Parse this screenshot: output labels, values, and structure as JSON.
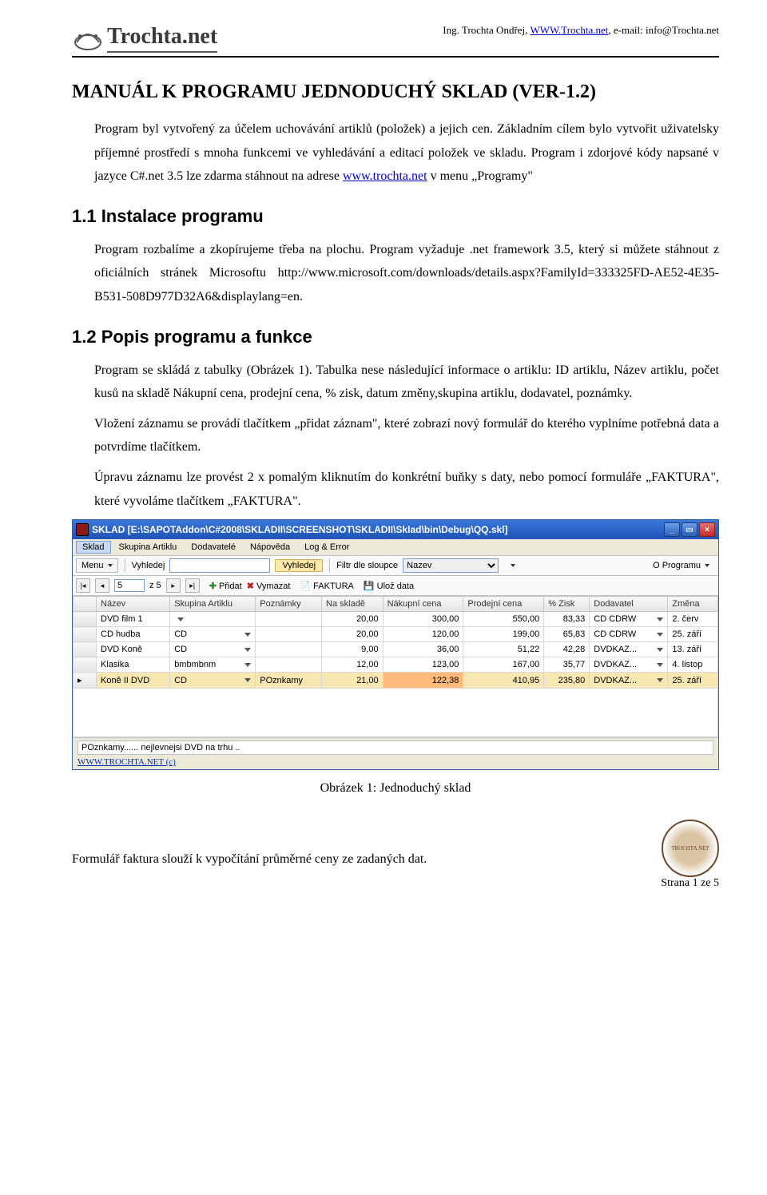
{
  "header": {
    "author": "Ing. Trochta Ondřej, ",
    "site_label": "WWW.Trochta.net",
    "email_prefix": ",  e-mail: ",
    "email": "info@Trochta.net",
    "logo_text": "Trochta.net"
  },
  "title": "MANUÁL K PROGRAMU JEDNODUCHÝ SKLAD (VER-1.2)",
  "intro_para1": "Program byl vytvořený za účelem uchovávání artiklů (položek) a jejich cen. Základním cílem bylo vytvořit uživatelsky příjemné prostředí s mnoha funkcemi ve vyhledávání a editací položek ve skladu. Program i zdorjové kódy napsané v jazyce C#.net 3.5 lze zdarma stáhnout na adrese ",
  "intro_link": "www.trochta.net",
  "intro_para1b": " v menu „Programy\"",
  "h2_install": "1.1  Instalace programu",
  "install_text": "Program rozbalíme a zkopírujeme třeba na plochu. Program vyžaduje .net framework 3.5, který si můžete stáhnout z oficiálních stránek Microsoftu http://www.microsoft.com/downloads/details.aspx?FamilyId=333325FD-AE52-4E35-B531-508D977D32A6&displaylang=en.",
  "h2_popis": "1.2  Popis programu a funkce",
  "popis_p1": "Program se skládá z tabulky (Obrázek 1). Tabulka nese následující informace o artiklu: ID artiklu, Název artiklu, počet kusů na skladě Nákupní cena, prodejní cena, % zisk, datum změny,skupina artiklu, dodavatel, poznámky.",
  "popis_p2": "Vložení záznamu se provádí tlačítkem „přidat záznam\", které zobrazí nový formulář do kterého vyplníme potřebná data a potvrdíme tlačítkem.",
  "popis_p3": "Úpravu záznamu lze provést  2 x pomalým kliknutím do konkrétní buňky s daty, nebo pomocí formuláře  „FAKTURA\", které vyvoláme tlačítkem „FAKTURA\".",
  "app": {
    "title": "SKLAD [E:\\SAPOTAddon\\C#2008\\SKLADII\\SCREENSHOT\\SKLADII\\Sklad\\bin\\Debug\\QQ.skl]",
    "menubar": [
      "Sklad",
      "Skupina Artiklu",
      "Dodavatelé",
      "Nápověda",
      "Log & Error"
    ],
    "toolbar": {
      "menu_btn": "Menu",
      "vyhledej_label": "Vyhledej",
      "vyhledej_btn": "Vyhledej",
      "filtr_label": "Filtr dle sloupce",
      "filtr_value": "Nazev",
      "oprogramu": "O Programu"
    },
    "toolbar2": {
      "page": "5",
      "z": "z 5",
      "pridat": "Přidat",
      "vymazat": "Vymazat",
      "faktura": "FAKTURA",
      "uloz": "Ulož data"
    },
    "columns": [
      "",
      "Název",
      "Skupina Artiklu",
      "Poznámky",
      "Na skladě",
      "Nákupní cena",
      "Prodejní cena",
      "% Zisk",
      "Dodavatel",
      "Změna"
    ],
    "rows": [
      {
        "nazev": "DVD film 1",
        "skupina": "",
        "pozn": "",
        "sklad": "20,00",
        "nakup": "300,00",
        "prodej": "550,00",
        "zisk": "83,33",
        "dodav": "CD CDRW",
        "zmena": "2. červ"
      },
      {
        "nazev": "CD hudba",
        "skupina": "CD",
        "pozn": "",
        "sklad": "20,00",
        "nakup": "120,00",
        "prodej": "199,00",
        "zisk": "65,83",
        "dodav": "CD CDRW",
        "zmena": "25. září"
      },
      {
        "nazev": "DVD Koně",
        "skupina": "CD",
        "pozn": "",
        "sklad": "9,00",
        "nakup": "36,00",
        "prodej": "51,22",
        "zisk": "42,28",
        "dodav": "DVDKAZ...",
        "zmena": "13. září"
      },
      {
        "nazev": "Klasika",
        "skupina": "bmbmbnm",
        "pozn": "",
        "sklad": "12,00",
        "nakup": "123,00",
        "prodej": "167,00",
        "zisk": "35,77",
        "dodav": "DVDKAZ...",
        "zmena": "4. listop"
      },
      {
        "nazev": "Koně II DVD",
        "skupina": "CD",
        "pozn": "POznkamy",
        "sklad": "21,00",
        "nakup": "122,38",
        "prodej": "410,95",
        "zisk": "235,80",
        "dodav": "DVDKAZ...",
        "zmena": "25. září",
        "selected": true,
        "hl_nakup": true
      }
    ],
    "status1": "POznkamy...... nejlevnejsi DVD na trhu ..",
    "status2": "WWW.TROCHTA.NET (c)"
  },
  "caption": "Obrázek 1: Jednoduchý sklad",
  "footer_text": "Formulář faktura slouží k vypočítání průměrné ceny ze zadaných dat.",
  "page_num": "Strana 1 ze 5"
}
